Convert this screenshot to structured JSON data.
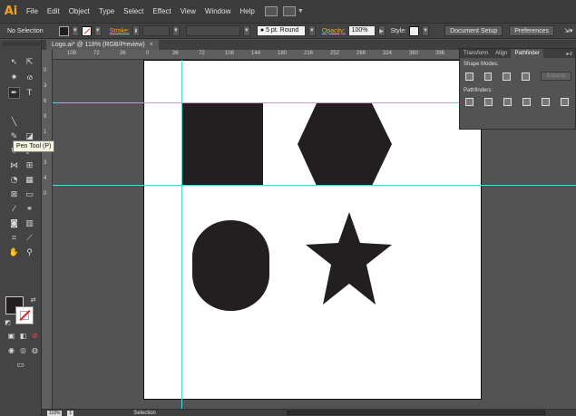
{
  "menubar": {
    "logo": "Ai",
    "items": [
      "File",
      "Edit",
      "Object",
      "Type",
      "Select",
      "Effect",
      "View",
      "Window",
      "Help"
    ]
  },
  "controlbar": {
    "selection_label": "No Selection",
    "stroke_label": "Stroke:",
    "brush_value": "5 pt. Round",
    "opacity_label": "Opacity:",
    "opacity_value": "100%",
    "style_label": "Style:",
    "document_setup_label": "Document Setup",
    "preferences_label": "Preferences"
  },
  "document_tab": {
    "title": "Logo.ai* @ 118% (RGB/Preview)",
    "close": "×"
  },
  "tooltip": {
    "text": "Pen Tool (P)"
  },
  "rulers": {
    "horizontal_ticks": [
      "108",
      "72",
      "36",
      "0",
      "36",
      "72",
      "108",
      "144",
      "180",
      "216",
      "252",
      "288",
      "324",
      "360",
      "396",
      "432"
    ],
    "vertical_ticks": [
      "0",
      "3",
      "6",
      "9",
      "1",
      "2",
      "3",
      "4",
      "0"
    ]
  },
  "pathfinder_panel": {
    "tabs": [
      "Transform",
      "Align",
      "Pathfinder"
    ],
    "active_tab": "Pathfinder",
    "shape_modes_label": "Shape Modes:",
    "pathfinders_label": "Pathfinders:",
    "expand_label": "Expand"
  },
  "statusbar": {
    "zoom": "118%",
    "page": "1",
    "tool": "Selection"
  },
  "colors": {
    "shape_fill": "#231f20",
    "guide": "#4fd6d6",
    "accent": "#f7a21b",
    "stroke_link": "#f0a830"
  }
}
